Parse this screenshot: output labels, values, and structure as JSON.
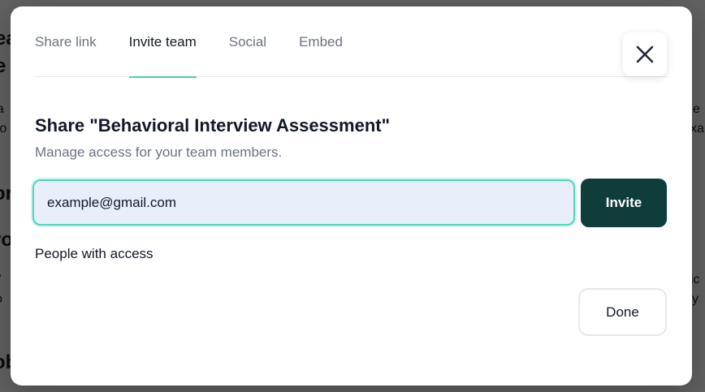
{
  "modal": {
    "tabs": [
      {
        "label": "Share link",
        "active": false
      },
      {
        "label": "Invite team",
        "active": true
      },
      {
        "label": "Social",
        "active": false
      },
      {
        "label": "Embed",
        "active": false
      }
    ],
    "close_icon": "close-icon",
    "title": "Share \"Behavioral Interview Assessment\"",
    "subtitle": "Manage access for your team members.",
    "email_input": {
      "value": "example@gmail.com",
      "placeholder": ""
    },
    "invite_label": "Invite",
    "people_label": "People with access",
    "done_label": "Done"
  },
  "colors": {
    "accent": "#3fd3b7",
    "invite_button": "#0f3d3b",
    "input_background": "#e8effb"
  }
}
